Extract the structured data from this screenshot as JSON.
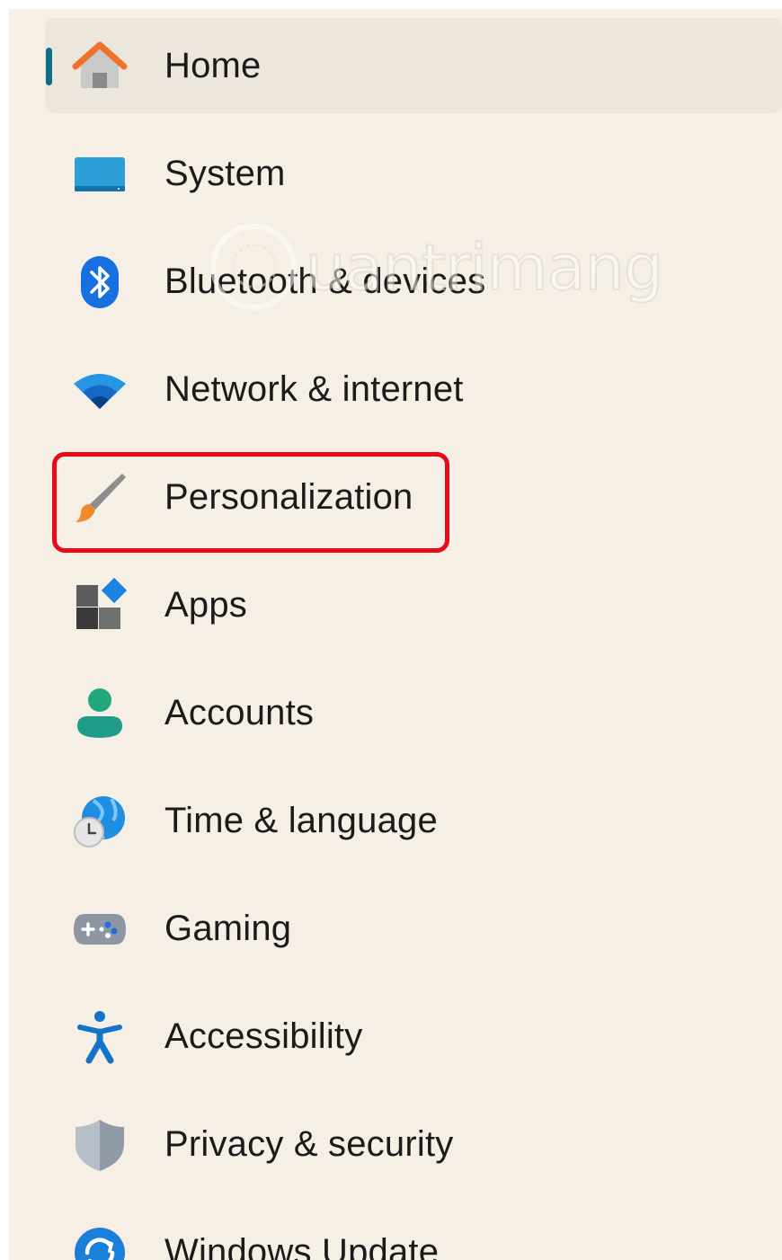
{
  "nav": {
    "items": [
      {
        "label": "Home",
        "icon": "home-icon",
        "selected": true
      },
      {
        "label": "System",
        "icon": "monitor-icon"
      },
      {
        "label": "Bluetooth & devices",
        "icon": "bluetooth-icon"
      },
      {
        "label": "Network & internet",
        "icon": "wifi-icon"
      },
      {
        "label": "Personalization",
        "icon": "paintbrush-icon",
        "highlighted": true
      },
      {
        "label": "Apps",
        "icon": "apps-icon"
      },
      {
        "label": "Accounts",
        "icon": "person-icon"
      },
      {
        "label": "Time & language",
        "icon": "globe-clock-icon"
      },
      {
        "label": "Gaming",
        "icon": "gamepad-icon"
      },
      {
        "label": "Accessibility",
        "icon": "accessibility-icon"
      },
      {
        "label": "Privacy & security",
        "icon": "shield-icon"
      },
      {
        "label": "Windows Update",
        "icon": "update-icon"
      }
    ]
  },
  "watermark": {
    "text": "uantrimang"
  },
  "colors": {
    "background": "#f6efe5",
    "selected_background": "#ede6dc",
    "indicator": "#0e6e87",
    "highlight_border": "#e8091a"
  }
}
